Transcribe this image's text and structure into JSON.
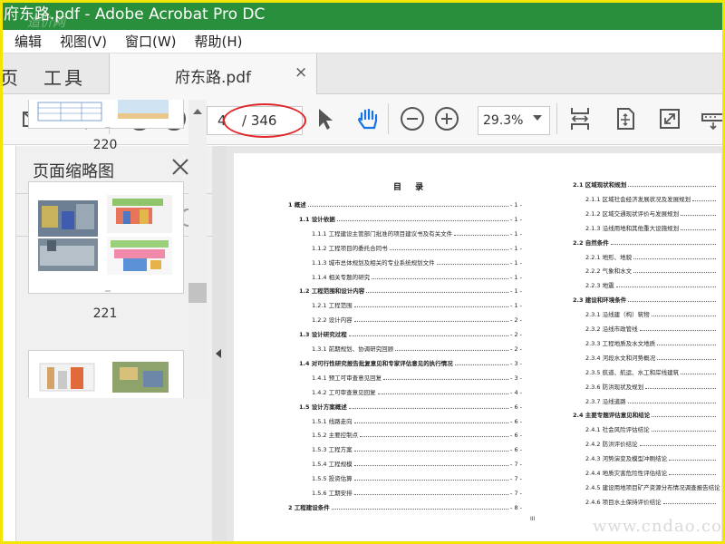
{
  "window": {
    "title": "府东路.pdf - Adobe Acrobat Pro DC",
    "overlay_watermark": "造价网"
  },
  "menu": [
    "编辑",
    "视图(V)",
    "窗口(W)",
    "帮助(H)"
  ],
  "tabs": {
    "home": "页",
    "tools": "工具",
    "file": "府东路.pdf",
    "close": "×"
  },
  "toolbar": {
    "current_page": "4",
    "total_pages": "/ 346",
    "zoom": "29.3%"
  },
  "panel": {
    "title": "页面缩略图",
    "thumbnails": [
      {
        "label": "220"
      },
      {
        "label": "221"
      },
      {
        "label": ""
      }
    ]
  },
  "document": {
    "toc_title": "目 录",
    "left_column": [
      {
        "text": "1 概述",
        "page": "- 1 -",
        "level": 0
      },
      {
        "text": "1.1 设计依据",
        "page": "- 1 -",
        "level": 1
      },
      {
        "text": "1.1.1 工程建设主管部门批准的项目建议书及有关文件",
        "page": "- 1 -",
        "level": 2
      },
      {
        "text": "1.1.2 工程项目的委托合同书",
        "page": "- 1 -",
        "level": 2
      },
      {
        "text": "1.1.3 城市总体规划及相关的专业系统规划文件",
        "page": "- 1 -",
        "level": 2
      },
      {
        "text": "1.1.4 相关专题的研究",
        "page": "- 1 -",
        "level": 2
      },
      {
        "text": "1.2 工程范围和设计内容",
        "page": "- 1 -",
        "level": 1
      },
      {
        "text": "1.2.1 工程范围",
        "page": "- 1 -",
        "level": 2
      },
      {
        "text": "1.2.2 设计内容",
        "page": "- 2 -",
        "level": 2
      },
      {
        "text": "1.3 设计研究过程",
        "page": "- 2 -",
        "level": 1
      },
      {
        "text": "1.3.1 前期规划、协调研究回顾",
        "page": "- 2 -",
        "level": 2
      },
      {
        "text": "1.4 对可行性研究报告批复意见和专家评估意见的执行情况",
        "page": "- 3 -",
        "level": 1
      },
      {
        "text": "1.4.1 预工可审查意见回复",
        "page": "- 3 -",
        "level": 2
      },
      {
        "text": "1.4.2 工可审查意见回复",
        "page": "- 4 -",
        "level": 2
      },
      {
        "text": "1.5 设计方案概述",
        "page": "- 6 -",
        "level": 1
      },
      {
        "text": "1.5.1 线路走向",
        "page": "- 6 -",
        "level": 2
      },
      {
        "text": "1.5.2 主要控制点",
        "page": "- 6 -",
        "level": 2
      },
      {
        "text": "1.5.3 工程方案",
        "page": "- 6 -",
        "level": 2
      },
      {
        "text": "1.5.4 工程规模",
        "page": "- 7 -",
        "level": 2
      },
      {
        "text": "1.5.5 投资估算",
        "page": "- 7 -",
        "level": 2
      },
      {
        "text": "1.5.6 工期安排",
        "page": "- 7 -",
        "level": 2
      },
      {
        "text": "2 工程建设条件",
        "page": "- 8 -",
        "level": 0
      }
    ],
    "right_column": [
      {
        "text": "2.1 区域现状和规划",
        "level": 1
      },
      {
        "text": "2.1.1 区域社会经济发展状况及发展规划",
        "level": 2
      },
      {
        "text": "2.1.2 区域交通现状评价与发展规划",
        "level": 2
      },
      {
        "text": "2.1.3 沿线用地和其他重大设施规划",
        "level": 2
      },
      {
        "text": "2.2 自然条件",
        "level": 1
      },
      {
        "text": "2.2.1 地形、地貌",
        "level": 2
      },
      {
        "text": "2.2.2 气象和水文",
        "level": 2
      },
      {
        "text": "2.2.3 地震",
        "level": 2
      },
      {
        "text": "2.3 建设和环境条件",
        "level": 1
      },
      {
        "text": "2.3.1 沿线建（构）筑物",
        "level": 2
      },
      {
        "text": "2.3.2 沿线市政管线",
        "level": 2
      },
      {
        "text": "2.3.3 工程地质及水文地质",
        "level": 2
      },
      {
        "text": "2.3.4 河段水文和河势概况",
        "level": 2
      },
      {
        "text": "2.3.5 航道、航运、水工和岸线建筑",
        "level": 2
      },
      {
        "text": "2.3.6 防洪现状及规划",
        "level": 2
      },
      {
        "text": "2.3.7 沿线道路",
        "level": 2
      },
      {
        "text": "2.4 主要专题评估意见和结论",
        "level": 1
      },
      {
        "text": "2.4.1 社会风险评估结论",
        "level": 2
      },
      {
        "text": "2.4.2 防洪评价结论",
        "level": 2
      },
      {
        "text": "2.4.3 河势演变及模型冲刷结论",
        "level": 2
      },
      {
        "text": "2.4.4 地质灾害危险性评估结论",
        "level": 2
      },
      {
        "text": "2.4.5 建设用地项目矿产资源分布情况调查报告结论",
        "level": 2
      },
      {
        "text": "2.4.6 项目水土保持评价结论",
        "level": 2
      }
    ],
    "page_marker": "III"
  },
  "watermark": "www.cndao.com",
  "colors": {
    "titlebar": "#2a8f3c",
    "frame": "#f2e600",
    "annotation": "#e0262a",
    "icon_blue": "#1473e6"
  }
}
